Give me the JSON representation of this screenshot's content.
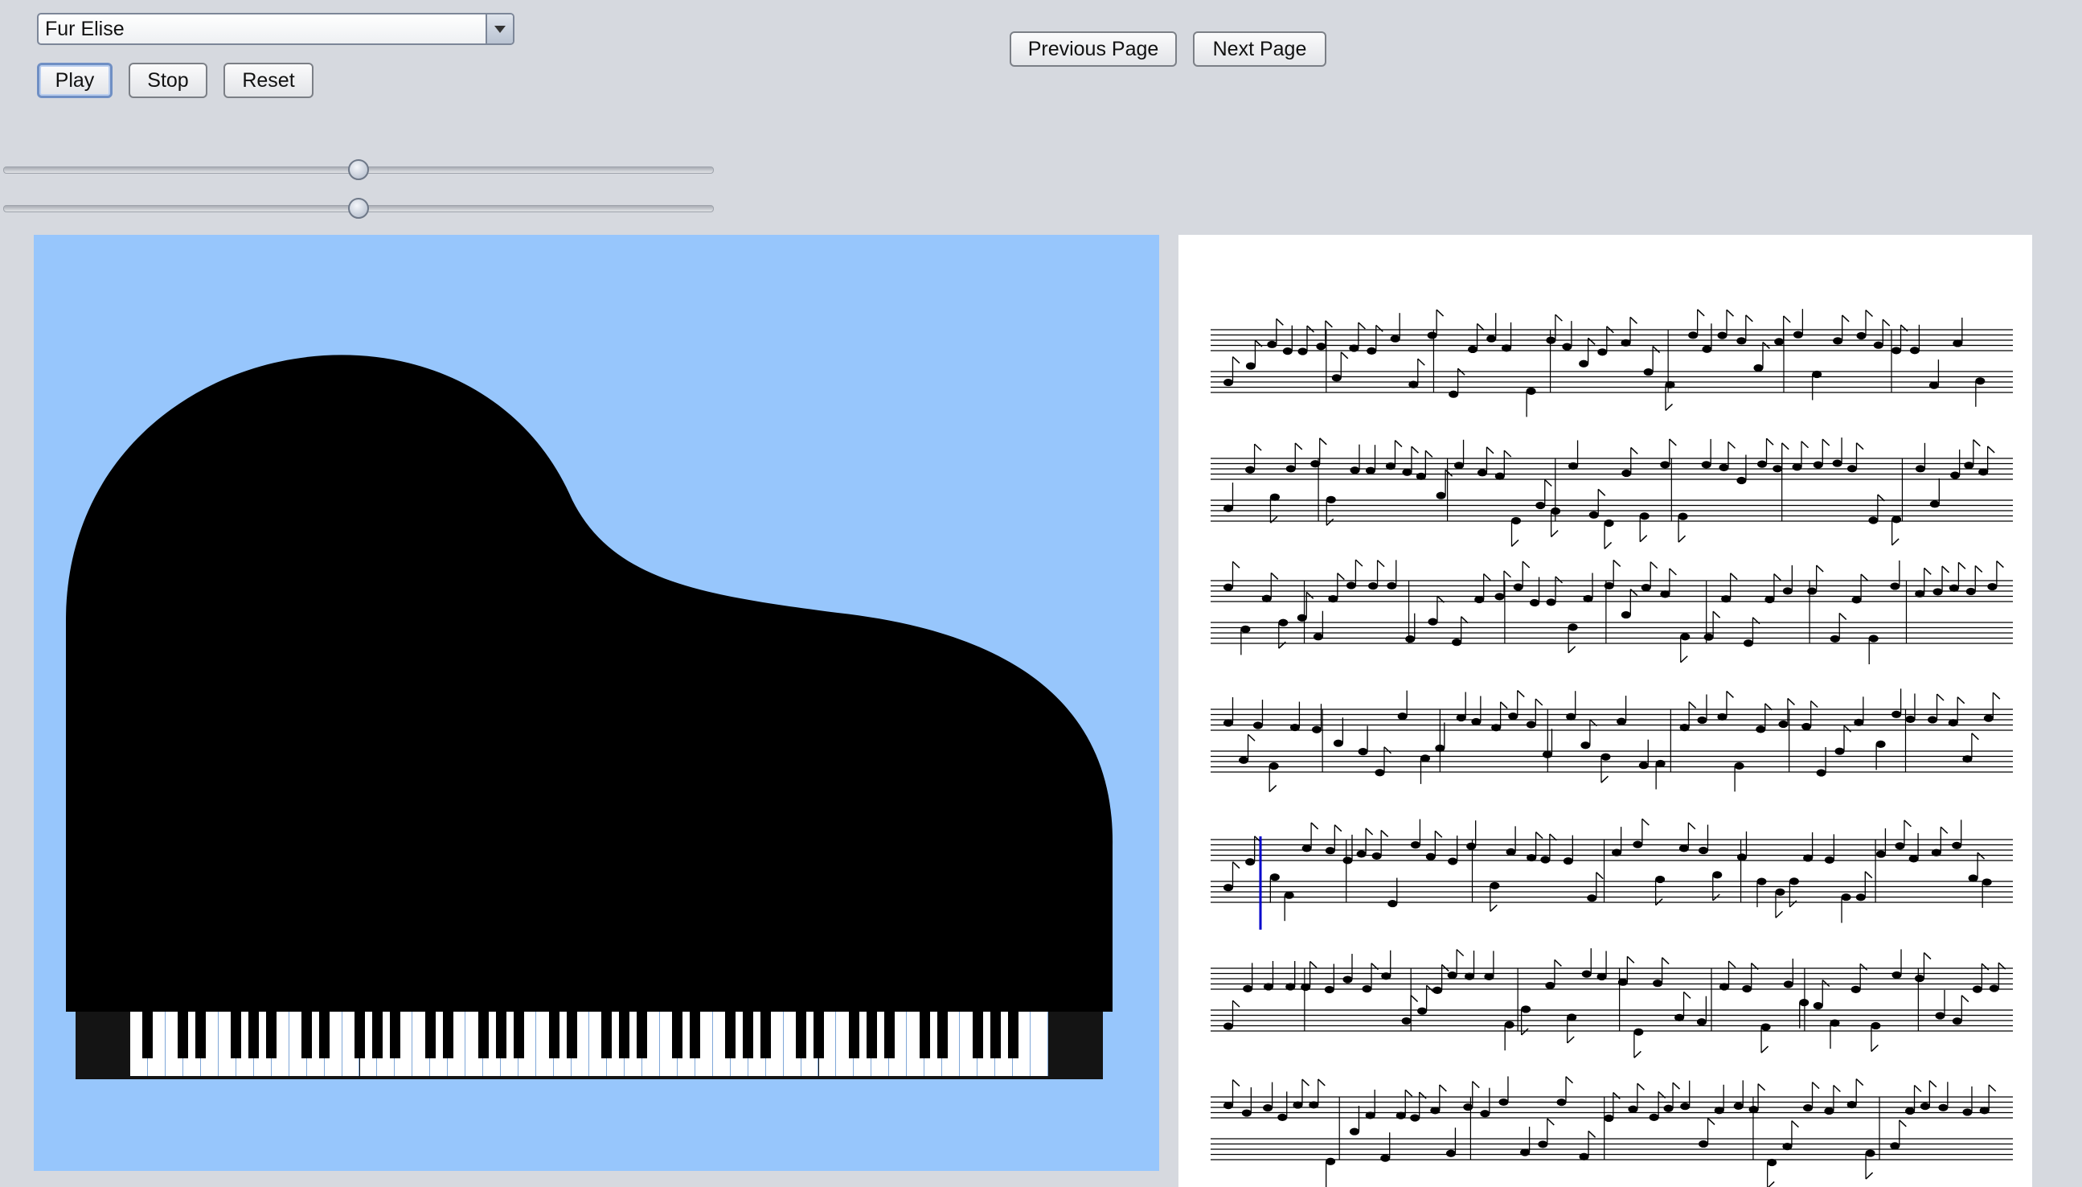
{
  "song_select": {
    "selected": "Fur Elise"
  },
  "controls": {
    "play": "Play",
    "stop": "Stop",
    "reset": "Reset",
    "previous_page": "Previous Page",
    "next_page": "Next Page"
  },
  "sliders": {
    "slider1_value": 0.5,
    "slider2_value": 0.5
  },
  "piano": {
    "white_keys": 52,
    "active_key": "black-key",
    "active_color": "#0000ee"
  },
  "colors": {
    "window_bg": "#d6d9df",
    "piano_panel_bg": "#97c6fc",
    "playhead": "#0000cc"
  }
}
